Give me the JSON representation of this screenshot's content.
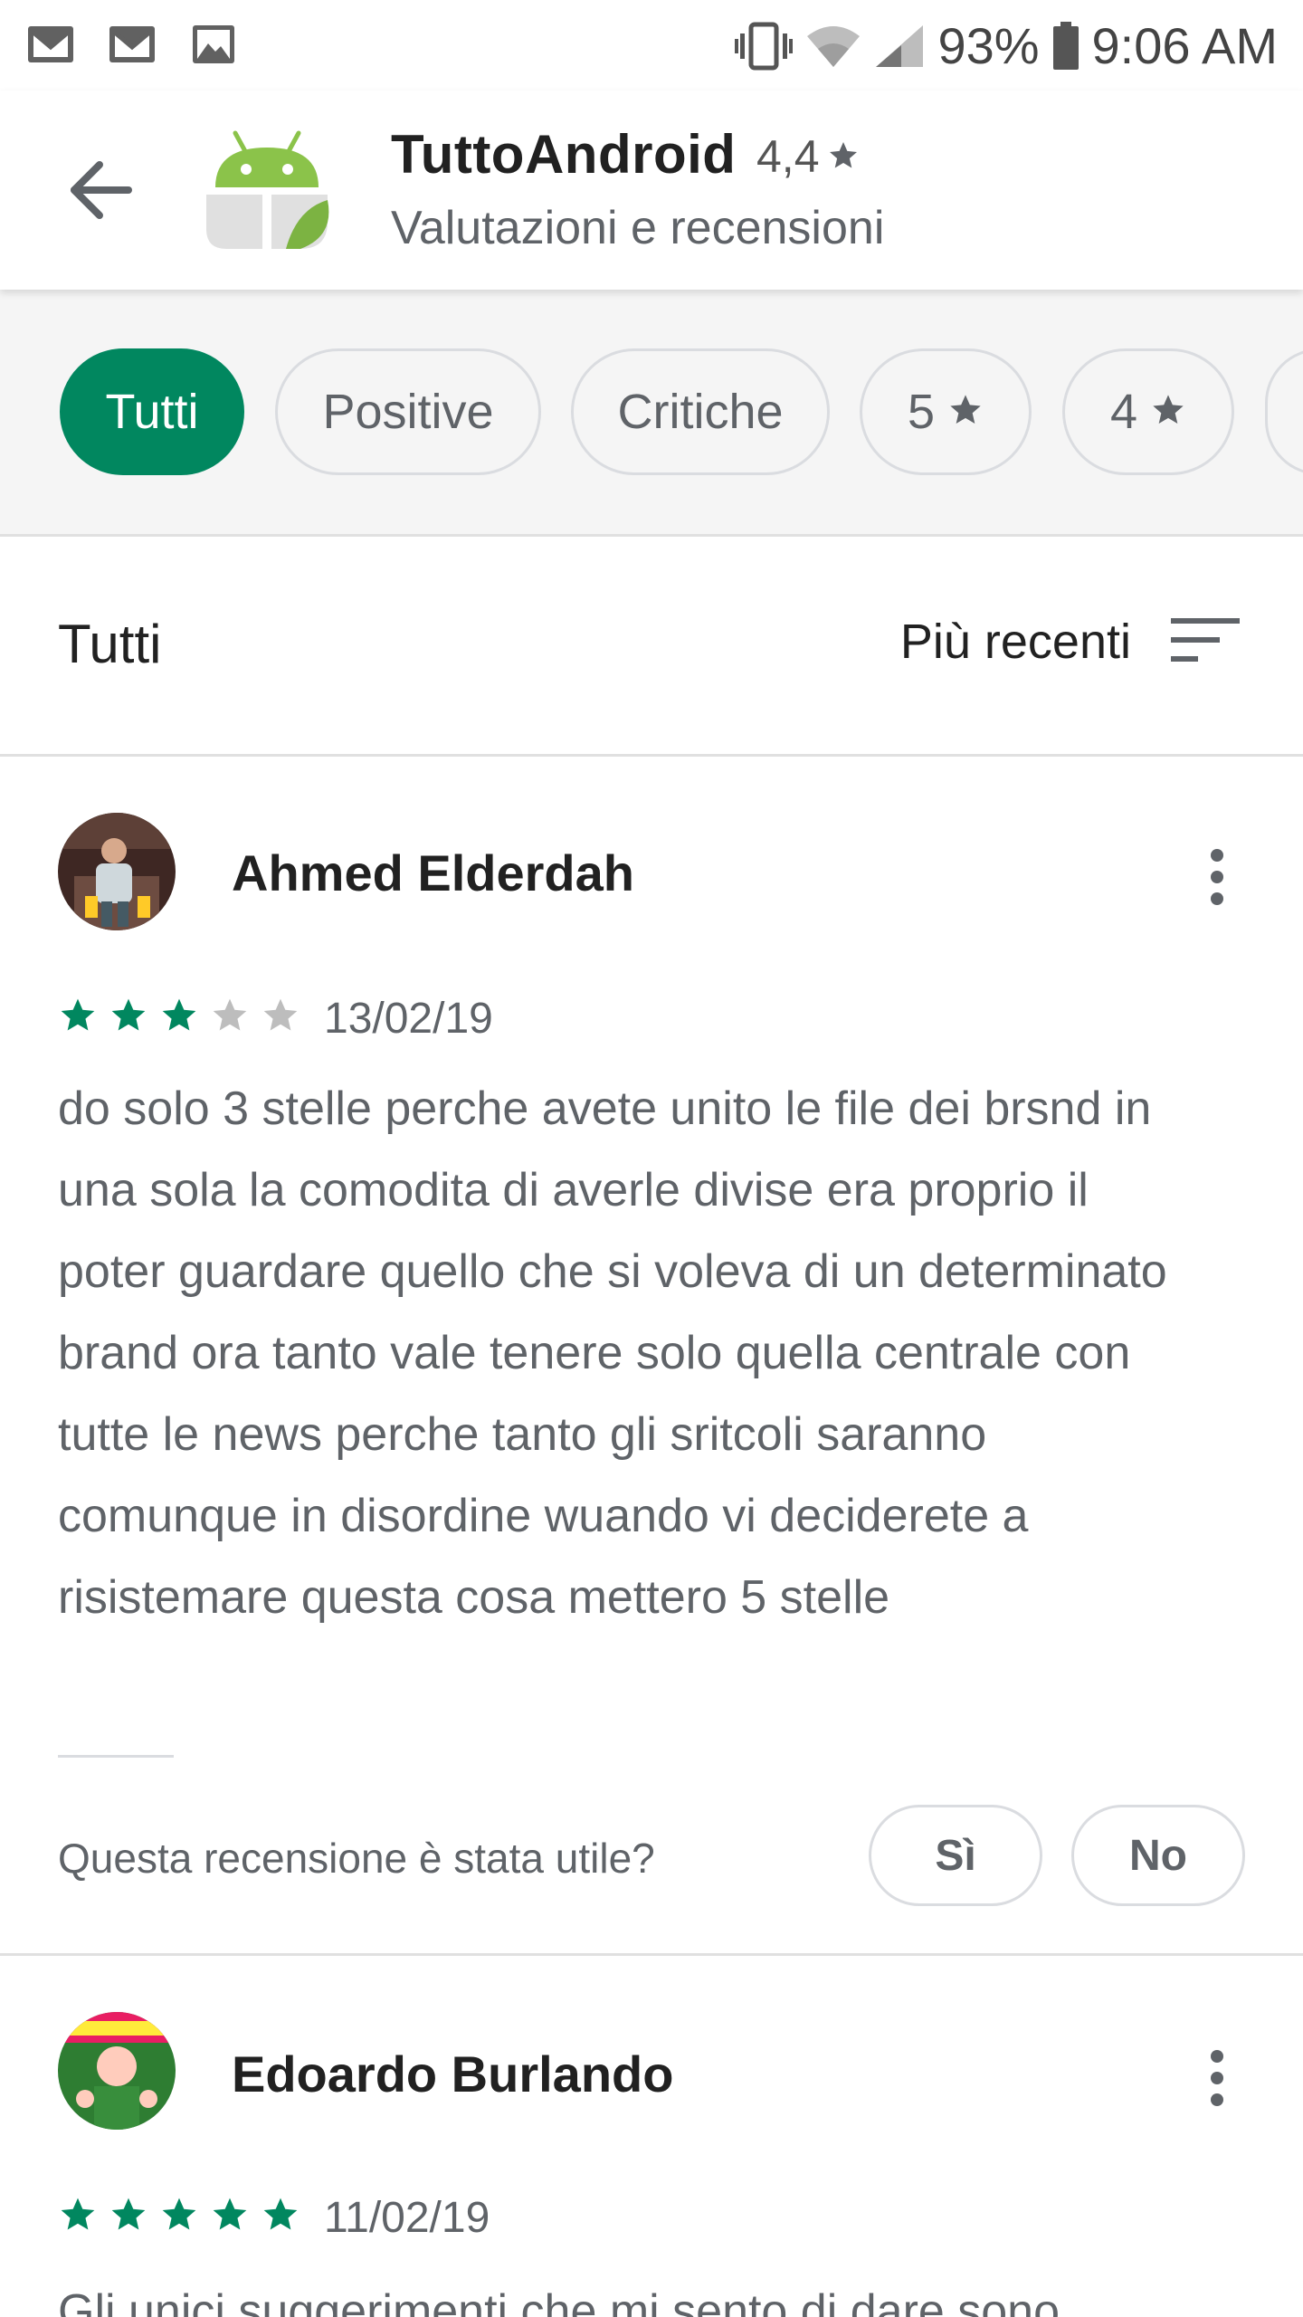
{
  "status_bar": {
    "battery": "93%",
    "time": "9:06 AM",
    "icons": [
      "gmail-icon",
      "gmail-icon",
      "image-icon",
      "vibrate-icon",
      "wifi-icon",
      "signal-icon",
      "battery-icon"
    ]
  },
  "header": {
    "app_name": "TuttoAndroid",
    "rating": "4,4",
    "subtitle": "Valutazioni e recensioni"
  },
  "filters": {
    "chips": [
      {
        "label": "Tutti",
        "active": true
      },
      {
        "label": "Positive",
        "active": false
      },
      {
        "label": "Critiche",
        "active": false
      },
      {
        "label": "5",
        "active": false
      },
      {
        "label": "4",
        "active": false
      }
    ]
  },
  "section": {
    "title": "Tutti",
    "sort_label": "Più recenti"
  },
  "reviews": [
    {
      "author": "Ahmed Elderdah",
      "rating": 3,
      "date": "13/02/19",
      "text": "do solo 3 stelle perche avete unito le file dei brsnd in una sola la comodita di averle divise era proprio il poter guardare quello che si voleva di un determinato brand ora tanto vale tenere solo quella centrale con tutte le news perche tanto gli sritcoli saranno comunque in disordine wuando vi deciderete a risistemare questa cosa mettero 5 stelle",
      "helpful_question": "Questa recensione è stata utile?",
      "yes_label": "Sì",
      "no_label": "No"
    },
    {
      "author": "Edoardo Burlando",
      "rating": 5,
      "date": "11/02/19",
      "text": "Gli unici suggerimenti che mi sento di dare sono"
    }
  ],
  "colors": {
    "accent": "#01875f",
    "star_filled": "#01875f",
    "star_empty": "#bdbdbd"
  }
}
